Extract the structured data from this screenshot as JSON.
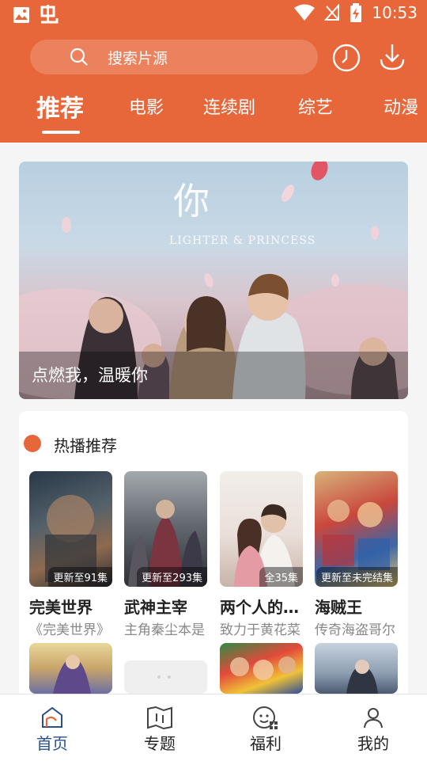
{
  "statusbar": {
    "time": "10:53"
  },
  "search": {
    "placeholder": "搜索片源"
  },
  "tabs": [
    "推荐",
    "电影",
    "连续剧",
    "综艺",
    "动漫"
  ],
  "banner": {
    "caption": "点燃我，温暖你",
    "title_art": "你",
    "subtitle_art": "LIGHTER & PRINCESS"
  },
  "section": {
    "title": "热播推荐"
  },
  "items": [
    {
      "title": "完美世界",
      "desc": "《完美世界》",
      "badge": "更新至91集"
    },
    {
      "title": "武神主宰",
      "desc": "主角秦尘本是",
      "badge": "更新至293集"
    },
    {
      "title": "两个人的…",
      "desc": "致力于黄花菜",
      "badge": "全35集"
    },
    {
      "title": "海贼王",
      "desc": "传奇海盗哥尔",
      "badge": "更新至未完结集"
    }
  ],
  "nav": [
    "首页",
    "专题",
    "福利",
    "我的"
  ],
  "colors": {
    "accent": "#e8673a",
    "nav_active": "#2a4f86"
  }
}
